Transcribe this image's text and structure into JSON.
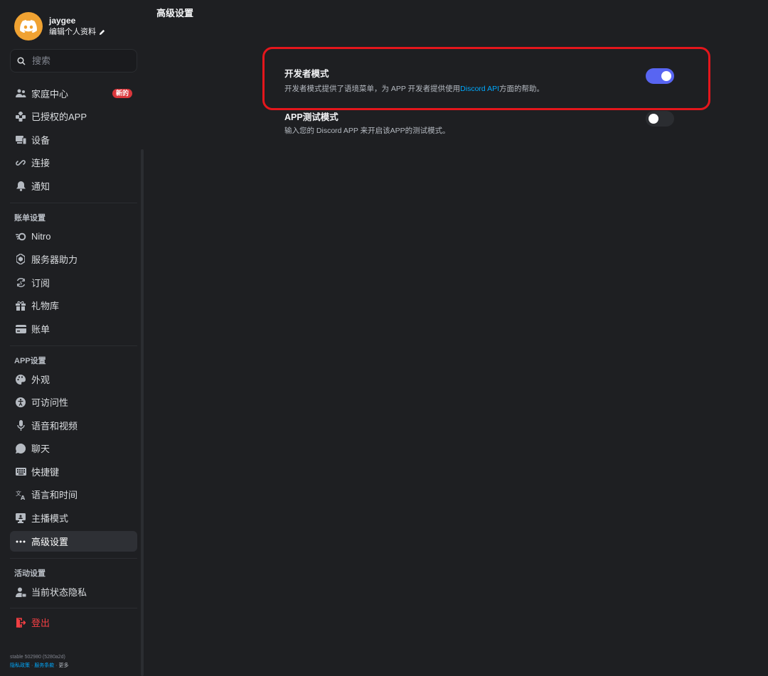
{
  "profile": {
    "username": "jaygee",
    "edit_label": "编辑个人资料",
    "avatar_color": "#f0a232"
  },
  "search": {
    "placeholder": "搜索"
  },
  "sidebar": {
    "user_items": [
      {
        "label": "家庭中心",
        "icon": "family-icon",
        "badge": "新的"
      },
      {
        "label": "已授权的APP",
        "icon": "authorized-apps-icon"
      },
      {
        "label": "设备",
        "icon": "devices-icon"
      },
      {
        "label": "连接",
        "icon": "link-icon"
      },
      {
        "label": "通知",
        "icon": "bell-icon"
      }
    ],
    "billing_header": "账单设置",
    "billing_items": [
      {
        "label": "Nitro",
        "icon": "nitro-icon"
      },
      {
        "label": "服务器助力",
        "icon": "boost-icon"
      },
      {
        "label": "订阅",
        "icon": "subscription-icon"
      },
      {
        "label": "礼物库",
        "icon": "gift-icon"
      },
      {
        "label": "账单",
        "icon": "card-icon"
      }
    ],
    "app_header": "APP设置",
    "app_items": [
      {
        "label": "外观",
        "icon": "palette-icon"
      },
      {
        "label": "可访问性",
        "icon": "accessibility-icon"
      },
      {
        "label": "语音和视频",
        "icon": "mic-icon"
      },
      {
        "label": "聊天",
        "icon": "chat-icon"
      },
      {
        "label": "快捷键",
        "icon": "keyboard-icon"
      },
      {
        "label": "语言和时间",
        "icon": "language-icon"
      },
      {
        "label": "主播模式",
        "icon": "streamer-icon"
      },
      {
        "label": "高级设置",
        "icon": "more-icon",
        "active": true
      }
    ],
    "activity_header": "活动设置",
    "activity_items": [
      {
        "label": "当前状态隐私",
        "icon": "activity-privacy-icon"
      }
    ],
    "logout": {
      "label": "登出",
      "icon": "logout-icon"
    }
  },
  "footer": {
    "version": "stable 502980 (5280a2d)",
    "privacy": "隐私政策",
    "sep1": " · ",
    "terms": "服务条款",
    "sep2": " · ",
    "more": "更多"
  },
  "main": {
    "title": "高级设置",
    "settings": [
      {
        "title": "开发者模式",
        "desc_before": "开发者模式提供了语境菜单，为 APP 开发者提供使用",
        "desc_link": "Discord API",
        "desc_after": "方面的帮助。",
        "enabled": true
      },
      {
        "title": "APP测试模式",
        "desc": "输入您的 Discord APP 来开启该APP的测试模式。",
        "enabled": false
      }
    ]
  },
  "colors": {
    "accent": "#5865f2",
    "highlight": "#e4161c",
    "link": "#00a8fc",
    "danger": "#f23f43"
  }
}
